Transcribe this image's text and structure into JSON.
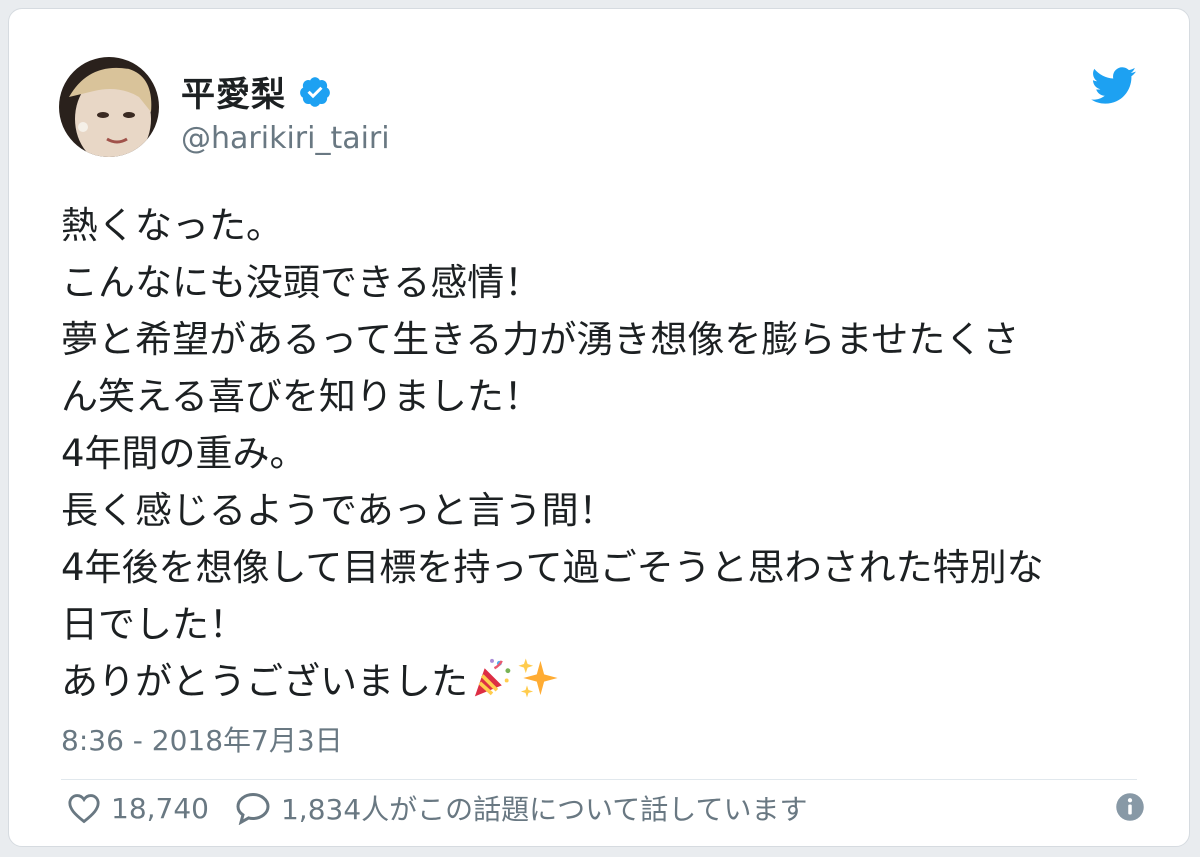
{
  "tweet": {
    "author": {
      "name": "平愛梨",
      "handle": "@harikiri_tairi",
      "verified": true
    },
    "lines": [
      "熱くなった。",
      "こんなにも没頭できる感情！",
      "夢と希望があるって生きる力が湧き想像を膨らませたくさ",
      "ん笑える喜びを知りました！",
      "4年間の重み。",
      "長く感じるようであっと言う間！",
      "4年後を想像して目標を持って過ごそうと思わされた特別な",
      "日でした！",
      "ありがとうございました"
    ],
    "trailing_emoji": [
      "party-popper-icon",
      "sparkles-icon"
    ],
    "timestamp": "8:36 - 2018年7月3日",
    "likes": "18,740",
    "conversation": "1,834人がこの話題について話しています"
  },
  "colors": {
    "primary_text": "#1c2022",
    "secondary_text": "#697882",
    "twitter_blue": "#1da1f2",
    "verified_blue": "#1da1f2"
  }
}
